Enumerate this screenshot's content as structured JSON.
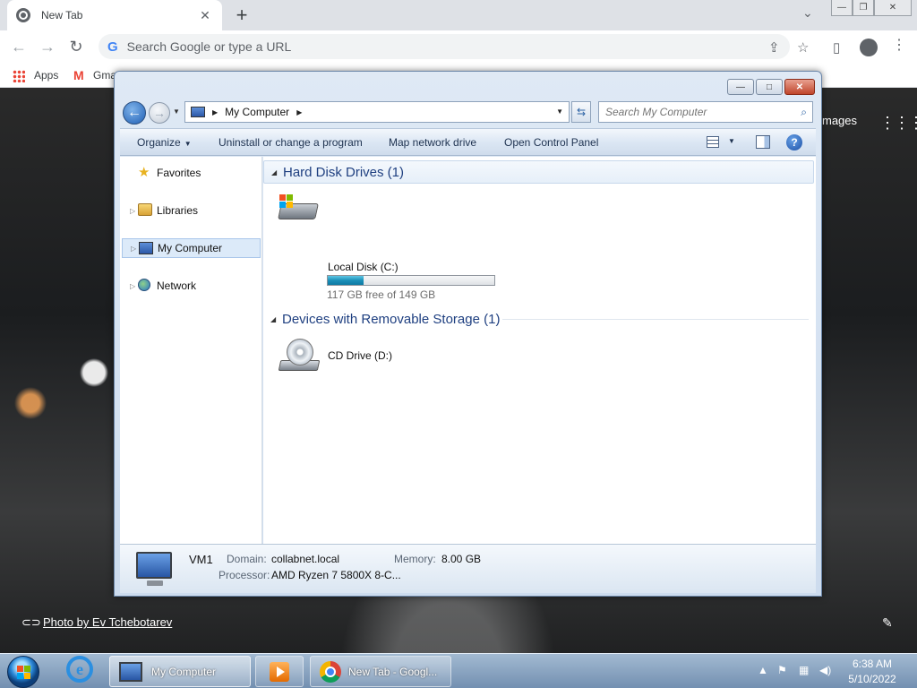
{
  "browser": {
    "tab_title": "New Tab",
    "tab_close": "✕",
    "new_tab": "+",
    "omnibox_placeholder": "Search Google or type a URL",
    "bookmarks": {
      "apps": "Apps",
      "gmail": "Gma"
    },
    "nav": {
      "back": "←",
      "forward": "→",
      "reload": "↻"
    },
    "controls": {
      "minimize": "—",
      "restore": "❐",
      "close": "✕"
    }
  },
  "wallpaper": {
    "photo_credit": "Photo by Ev Tchebotarev",
    "images_link": "mages"
  },
  "explorer": {
    "controls": {
      "minimize": "—",
      "maximize": "□",
      "close": "✕"
    },
    "address": {
      "location": "My Computer"
    },
    "search_placeholder": "Search My Computer",
    "commands": {
      "organize": "Organize",
      "uninstall": "Uninstall or change a program",
      "map_drive": "Map network drive",
      "control_panel": "Open Control Panel",
      "help": "?"
    },
    "nav_items": [
      {
        "label": "Favorites"
      },
      {
        "label": "Libraries"
      },
      {
        "label": "My Computer"
      },
      {
        "label": "Network"
      }
    ],
    "groups": {
      "hdd": {
        "title": "Hard Disk Drives (1)",
        "drive": {
          "name": "Local Disk (C:)",
          "free_text": "117 GB free of 149 GB",
          "used_fraction": 0.215
        }
      },
      "removable": {
        "title": "Devices with Removable Storage (1)",
        "drive": {
          "name": "CD Drive (D:)"
        }
      }
    },
    "details": {
      "computer_name": "VM1",
      "domain_label": "Domain:",
      "domain_value": "collabnet.local",
      "memory_label": "Memory:",
      "memory_value": "8.00 GB",
      "processor_label": "Processor:",
      "processor_value": "AMD Ryzen 7 5800X 8-C..."
    }
  },
  "taskbar": {
    "items": [
      {
        "label": "My Computer"
      },
      {
        "label": "New Tab - Googl..."
      }
    ],
    "clock": {
      "time": "6:38 AM",
      "date": "5/10/2022"
    }
  }
}
